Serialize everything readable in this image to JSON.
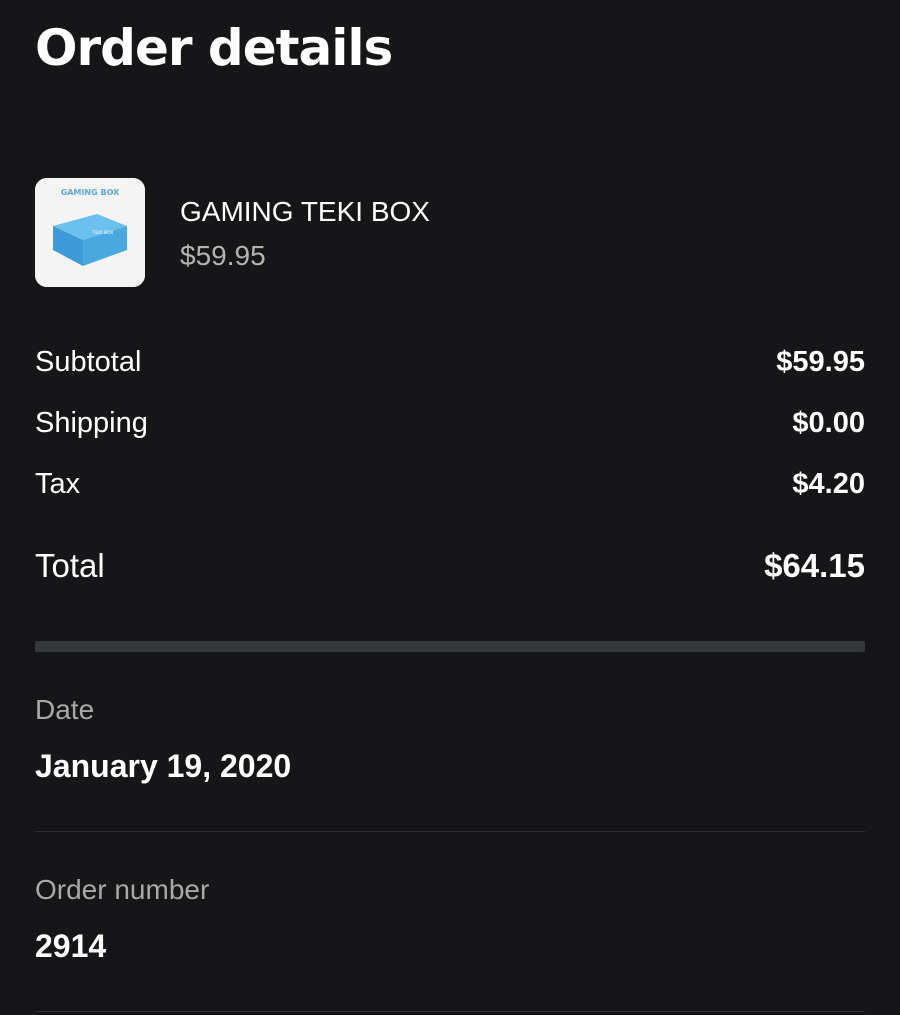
{
  "header": {
    "title": "Order details"
  },
  "product": {
    "name": "GAMING TEKI BOX",
    "price": "$59.95",
    "image": {
      "icon": "product-box-image",
      "brand_label": "GAMING BOX",
      "box_label": "TEKI BOX"
    }
  },
  "summary": {
    "subtotal_label": "Subtotal",
    "subtotal_value": "$59.95",
    "shipping_label": "Shipping",
    "shipping_value": "$0.00",
    "tax_label": "Tax",
    "tax_value": "$4.20",
    "total_label": "Total",
    "total_value": "$64.15"
  },
  "details": {
    "date_label": "Date",
    "date_value": "January 19, 2020",
    "order_number_label": "Order number",
    "order_number_value": "2914"
  },
  "colors": {
    "background": "#161618",
    "primary_text": "#ffffff",
    "secondary_text": "#a8a8a8",
    "divider": "#34373b",
    "box_blue": "#4aa8e0"
  }
}
